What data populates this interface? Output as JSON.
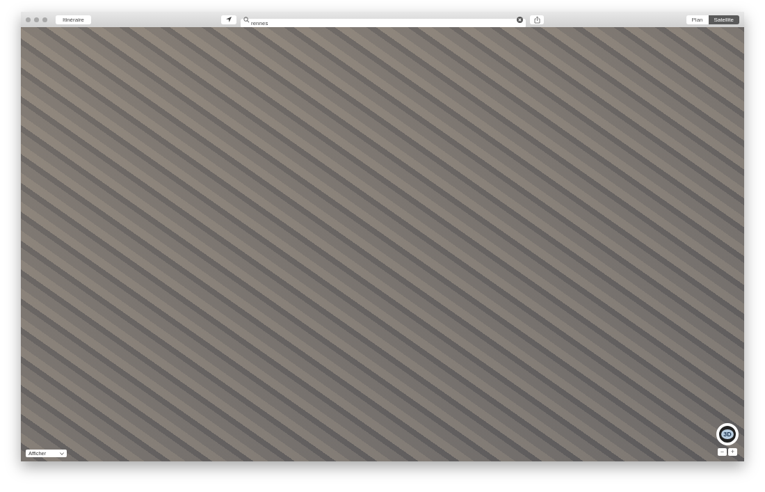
{
  "toolbar": {
    "directions_button": "Itinéraire",
    "search": {
      "value": "rennes"
    },
    "view_tabs": [
      {
        "label": "Plan",
        "selected": false
      },
      {
        "label": "Satellite",
        "selected": true
      }
    ]
  },
  "map": {
    "display_menu": "Afficher",
    "compass_label": "3D",
    "zoom_out": "−",
    "zoom_in": "+"
  }
}
